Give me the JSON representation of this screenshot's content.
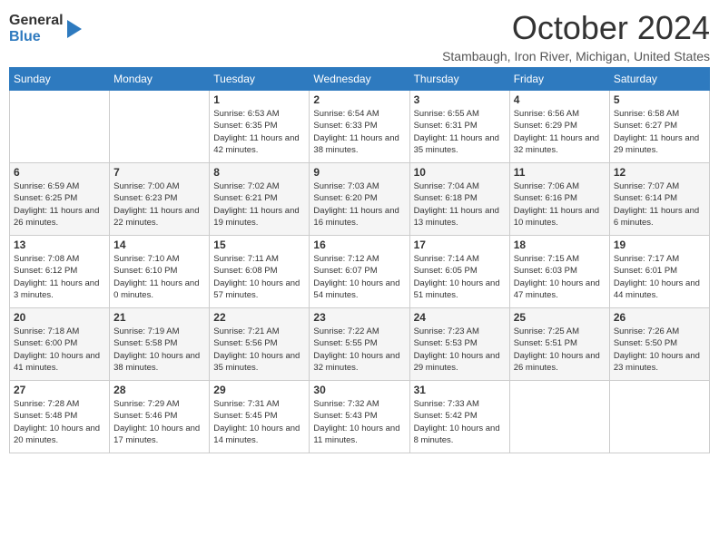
{
  "logo": {
    "general": "General",
    "blue": "Blue"
  },
  "title": "October 2024",
  "location": "Stambaugh, Iron River, Michigan, United States",
  "days_of_week": [
    "Sunday",
    "Monday",
    "Tuesday",
    "Wednesday",
    "Thursday",
    "Friday",
    "Saturday"
  ],
  "weeks": [
    [
      {
        "day": "",
        "info": ""
      },
      {
        "day": "",
        "info": ""
      },
      {
        "day": "1",
        "info": "Sunrise: 6:53 AM\nSunset: 6:35 PM\nDaylight: 11 hours and 42 minutes."
      },
      {
        "day": "2",
        "info": "Sunrise: 6:54 AM\nSunset: 6:33 PM\nDaylight: 11 hours and 38 minutes."
      },
      {
        "day": "3",
        "info": "Sunrise: 6:55 AM\nSunset: 6:31 PM\nDaylight: 11 hours and 35 minutes."
      },
      {
        "day": "4",
        "info": "Sunrise: 6:56 AM\nSunset: 6:29 PM\nDaylight: 11 hours and 32 minutes."
      },
      {
        "day": "5",
        "info": "Sunrise: 6:58 AM\nSunset: 6:27 PM\nDaylight: 11 hours and 29 minutes."
      }
    ],
    [
      {
        "day": "6",
        "info": "Sunrise: 6:59 AM\nSunset: 6:25 PM\nDaylight: 11 hours and 26 minutes."
      },
      {
        "day": "7",
        "info": "Sunrise: 7:00 AM\nSunset: 6:23 PM\nDaylight: 11 hours and 22 minutes."
      },
      {
        "day": "8",
        "info": "Sunrise: 7:02 AM\nSunset: 6:21 PM\nDaylight: 11 hours and 19 minutes."
      },
      {
        "day": "9",
        "info": "Sunrise: 7:03 AM\nSunset: 6:20 PM\nDaylight: 11 hours and 16 minutes."
      },
      {
        "day": "10",
        "info": "Sunrise: 7:04 AM\nSunset: 6:18 PM\nDaylight: 11 hours and 13 minutes."
      },
      {
        "day": "11",
        "info": "Sunrise: 7:06 AM\nSunset: 6:16 PM\nDaylight: 11 hours and 10 minutes."
      },
      {
        "day": "12",
        "info": "Sunrise: 7:07 AM\nSunset: 6:14 PM\nDaylight: 11 hours and 6 minutes."
      }
    ],
    [
      {
        "day": "13",
        "info": "Sunrise: 7:08 AM\nSunset: 6:12 PM\nDaylight: 11 hours and 3 minutes."
      },
      {
        "day": "14",
        "info": "Sunrise: 7:10 AM\nSunset: 6:10 PM\nDaylight: 11 hours and 0 minutes."
      },
      {
        "day": "15",
        "info": "Sunrise: 7:11 AM\nSunset: 6:08 PM\nDaylight: 10 hours and 57 minutes."
      },
      {
        "day": "16",
        "info": "Sunrise: 7:12 AM\nSunset: 6:07 PM\nDaylight: 10 hours and 54 minutes."
      },
      {
        "day": "17",
        "info": "Sunrise: 7:14 AM\nSunset: 6:05 PM\nDaylight: 10 hours and 51 minutes."
      },
      {
        "day": "18",
        "info": "Sunrise: 7:15 AM\nSunset: 6:03 PM\nDaylight: 10 hours and 47 minutes."
      },
      {
        "day": "19",
        "info": "Sunrise: 7:17 AM\nSunset: 6:01 PM\nDaylight: 10 hours and 44 minutes."
      }
    ],
    [
      {
        "day": "20",
        "info": "Sunrise: 7:18 AM\nSunset: 6:00 PM\nDaylight: 10 hours and 41 minutes."
      },
      {
        "day": "21",
        "info": "Sunrise: 7:19 AM\nSunset: 5:58 PM\nDaylight: 10 hours and 38 minutes."
      },
      {
        "day": "22",
        "info": "Sunrise: 7:21 AM\nSunset: 5:56 PM\nDaylight: 10 hours and 35 minutes."
      },
      {
        "day": "23",
        "info": "Sunrise: 7:22 AM\nSunset: 5:55 PM\nDaylight: 10 hours and 32 minutes."
      },
      {
        "day": "24",
        "info": "Sunrise: 7:23 AM\nSunset: 5:53 PM\nDaylight: 10 hours and 29 minutes."
      },
      {
        "day": "25",
        "info": "Sunrise: 7:25 AM\nSunset: 5:51 PM\nDaylight: 10 hours and 26 minutes."
      },
      {
        "day": "26",
        "info": "Sunrise: 7:26 AM\nSunset: 5:50 PM\nDaylight: 10 hours and 23 minutes."
      }
    ],
    [
      {
        "day": "27",
        "info": "Sunrise: 7:28 AM\nSunset: 5:48 PM\nDaylight: 10 hours and 20 minutes."
      },
      {
        "day": "28",
        "info": "Sunrise: 7:29 AM\nSunset: 5:46 PM\nDaylight: 10 hours and 17 minutes."
      },
      {
        "day": "29",
        "info": "Sunrise: 7:31 AM\nSunset: 5:45 PM\nDaylight: 10 hours and 14 minutes."
      },
      {
        "day": "30",
        "info": "Sunrise: 7:32 AM\nSunset: 5:43 PM\nDaylight: 10 hours and 11 minutes."
      },
      {
        "day": "31",
        "info": "Sunrise: 7:33 AM\nSunset: 5:42 PM\nDaylight: 10 hours and 8 minutes."
      },
      {
        "day": "",
        "info": ""
      },
      {
        "day": "",
        "info": ""
      }
    ]
  ]
}
